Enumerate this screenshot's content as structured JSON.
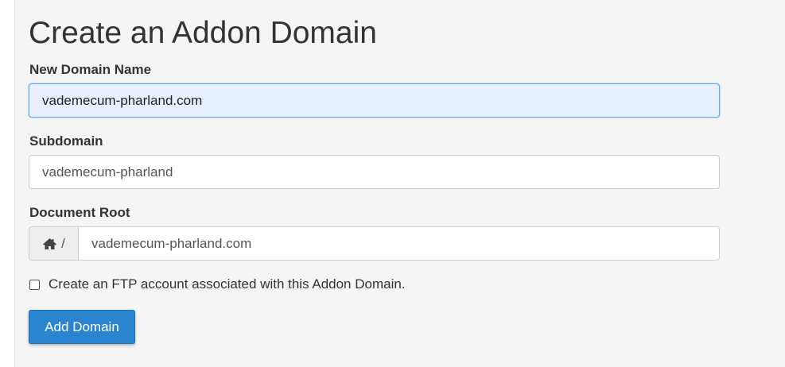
{
  "page": {
    "title": "Create an Addon Domain"
  },
  "form": {
    "new_domain": {
      "label": "New Domain Name",
      "value": "vademecum-pharland.com"
    },
    "subdomain": {
      "label": "Subdomain",
      "value": "vademecum-pharland"
    },
    "document_root": {
      "label": "Document Root",
      "prefix_icon": "home-icon",
      "prefix_text": "/",
      "value": "vademecum-pharland.com"
    },
    "ftp_checkbox": {
      "label": "Create an FTP account associated with this Addon Domain.",
      "checked": false
    },
    "submit_label": "Add Domain"
  },
  "colors": {
    "primary_button": "#2b84d0",
    "focused_input_bg": "#e8f0fe",
    "focused_input_border": "#66afe9"
  }
}
